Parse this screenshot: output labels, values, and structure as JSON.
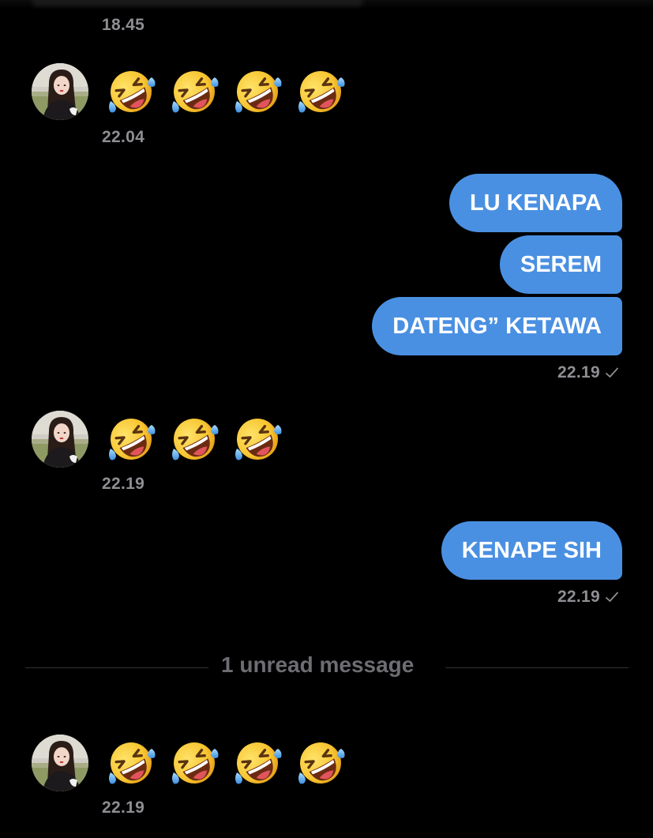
{
  "colors": {
    "background": "#000000",
    "bubble": "#4a90e2",
    "timestamp": "#8e8e93",
    "divider_text": "#6d6d72"
  },
  "messages": {
    "top_timestamp": "18.45",
    "incoming_1": {
      "emoji": [
        "rofl",
        "rofl",
        "rofl",
        "rofl"
      ],
      "timestamp": "22.04"
    },
    "outgoing_1": {
      "bubbles": [
        "LU KENAPA",
        "SEREM",
        "DATENG” KETAWA"
      ],
      "timestamp": "22.19"
    },
    "incoming_2": {
      "emoji": [
        "rofl",
        "rofl",
        "rofl"
      ],
      "timestamp": "22.19"
    },
    "outgoing_2": {
      "bubbles": [
        "KENAPE SIH"
      ],
      "timestamp": "22.19"
    },
    "unread_divider": "1 unread message",
    "incoming_3": {
      "emoji": [
        "rofl",
        "rofl",
        "rofl",
        "rofl"
      ],
      "timestamp": "22.19"
    }
  },
  "icons": {
    "avatar": "avatar-photo",
    "emoji": "rolling-on-the-floor-laughing-emoji",
    "read_receipt": "checkmark-icon"
  }
}
